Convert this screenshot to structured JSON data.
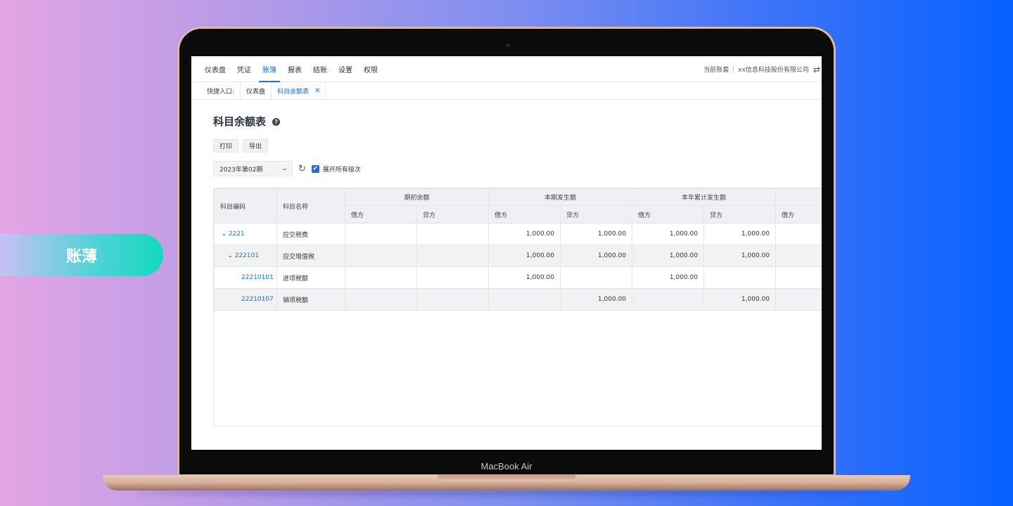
{
  "badge": {
    "label": "账薄"
  },
  "device": {
    "model": "MacBook Air"
  },
  "nav": {
    "items": [
      "仪表盘",
      "凭证",
      "账簿",
      "报表",
      "结账",
      "设置",
      "权限"
    ],
    "active_index": 2,
    "account_set_label": "当前账套",
    "company": "xx信息科技股份有限公司",
    "swap_icon": "⇄"
  },
  "quickbar": {
    "label": "快捷入口:",
    "tabs": [
      "仪表盘",
      "科目余额表"
    ],
    "active_tab": "科目余额表",
    "close_icon": "✕"
  },
  "page": {
    "title": "科目余额表",
    "help_icon": "?"
  },
  "toolbar": {
    "print_label": "打印",
    "export_label": "导出"
  },
  "filter": {
    "period": "2023年第02期",
    "expand_all_label": "展开所有级次",
    "expand_all_checked": true
  },
  "table": {
    "col_code": "科目编码",
    "col_name": "科目名称",
    "groups": [
      "期初余额",
      "本期发生额",
      "本年累计发生额"
    ],
    "debit": "借方",
    "credit": "贷方",
    "rows": [
      {
        "code": "2221",
        "name": "应交税费",
        "level": 1,
        "expanded": true,
        "open_debit": "",
        "open_credit": "",
        "period_debit": "1,000.00",
        "period_credit": "1,000.00",
        "ytd_debit": "1,000.00",
        "ytd_credit": "1,000.00"
      },
      {
        "code": "222101",
        "name": "应交增值税",
        "level": 2,
        "expanded": true,
        "open_debit": "",
        "open_credit": "",
        "period_debit": "1,000.00",
        "period_credit": "1,000.00",
        "ytd_debit": "1,000.00",
        "ytd_credit": "1,000.00"
      },
      {
        "code": "22210101",
        "name": "进项税额",
        "level": 3,
        "expanded": false,
        "open_debit": "",
        "open_credit": "",
        "period_debit": "1,000.00",
        "period_credit": "",
        "ytd_debit": "1,000.00",
        "ytd_credit": ""
      },
      {
        "code": "22210107",
        "name": "销项税额",
        "level": 3,
        "expanded": false,
        "open_debit": "",
        "open_credit": "",
        "period_debit": "",
        "period_credit": "1,000.00",
        "ytd_debit": "",
        "ytd_credit": "1,000.00"
      }
    ]
  }
}
